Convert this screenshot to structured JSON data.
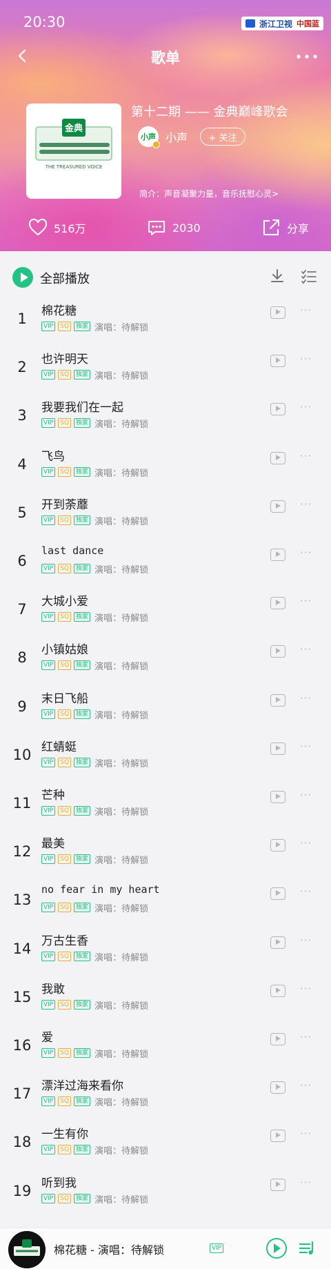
{
  "status": {
    "time": "20:30",
    "brand_left": "浙江卫视",
    "brand_right": "中国蓝"
  },
  "nav": {
    "title": "歌单",
    "back_icon": "back-icon",
    "more_icon": "more-icon"
  },
  "album": {
    "title": "第十二期 —— 金典巅峰歌会",
    "cover_text": "金典",
    "cover_sub": "THE TREASURED VOICE",
    "creator": {
      "avatar_text": "小声",
      "name": "小声"
    },
    "follow_label": "+ 关注",
    "intro": "简介：声音凝聚力量，音乐抚慰心灵>"
  },
  "stats": {
    "likes": "516万",
    "comments": "2030",
    "share": "分享"
  },
  "list_header": {
    "play_all": "全部播放"
  },
  "tags": {
    "vip": "VIP",
    "sq": "SQ",
    "exclusive": "独家"
  },
  "songs": [
    {
      "rank": "1",
      "title": "棉花糖",
      "singer": "演唱：待解锁"
    },
    {
      "rank": "2",
      "title": "也许明天",
      "singer": "演唱：待解锁"
    },
    {
      "rank": "3",
      "title": "我要我们在一起",
      "singer": "演唱：待解锁"
    },
    {
      "rank": "4",
      "title": "飞鸟",
      "singer": "演唱：待解锁"
    },
    {
      "rank": "5",
      "title": "开到荼蘼",
      "singer": "演唱：待解锁"
    },
    {
      "rank": "6",
      "title": "last dance",
      "singer": "演唱：待解锁"
    },
    {
      "rank": "7",
      "title": "大城小爱",
      "singer": "演唱：待解锁"
    },
    {
      "rank": "8",
      "title": "小镇姑娘",
      "singer": "演唱：待解锁"
    },
    {
      "rank": "9",
      "title": "末日飞船",
      "singer": "演唱：待解锁"
    },
    {
      "rank": "10",
      "title": "红蜻蜓",
      "singer": "演唱：待解锁"
    },
    {
      "rank": "11",
      "title": "芒种",
      "singer": "演唱：待解锁"
    },
    {
      "rank": "12",
      "title": "最美",
      "singer": "演唱：待解锁"
    },
    {
      "rank": "13",
      "title": "no fear in my heart",
      "singer": "演唱：待解锁"
    },
    {
      "rank": "14",
      "title": "万古生香",
      "singer": "演唱：待解锁"
    },
    {
      "rank": "15",
      "title": "我敢",
      "singer": "演唱：待解锁"
    },
    {
      "rank": "16",
      "title": "爱",
      "singer": "演唱：待解锁"
    },
    {
      "rank": "17",
      "title": "漂洋过海来看你",
      "singer": "演唱：待解锁"
    },
    {
      "rank": "18",
      "title": "一生有你",
      "singer": "演唱：待解锁"
    },
    {
      "rank": "19",
      "title": "听到我",
      "singer": "演唱：待解锁"
    }
  ],
  "player": {
    "now_playing": "棉花糖 - 演唱：待解锁",
    "vip": "VIP"
  },
  "colors": {
    "accent": "#25c285",
    "vip": "#2bbf8a",
    "sq": "#e2b23a"
  }
}
